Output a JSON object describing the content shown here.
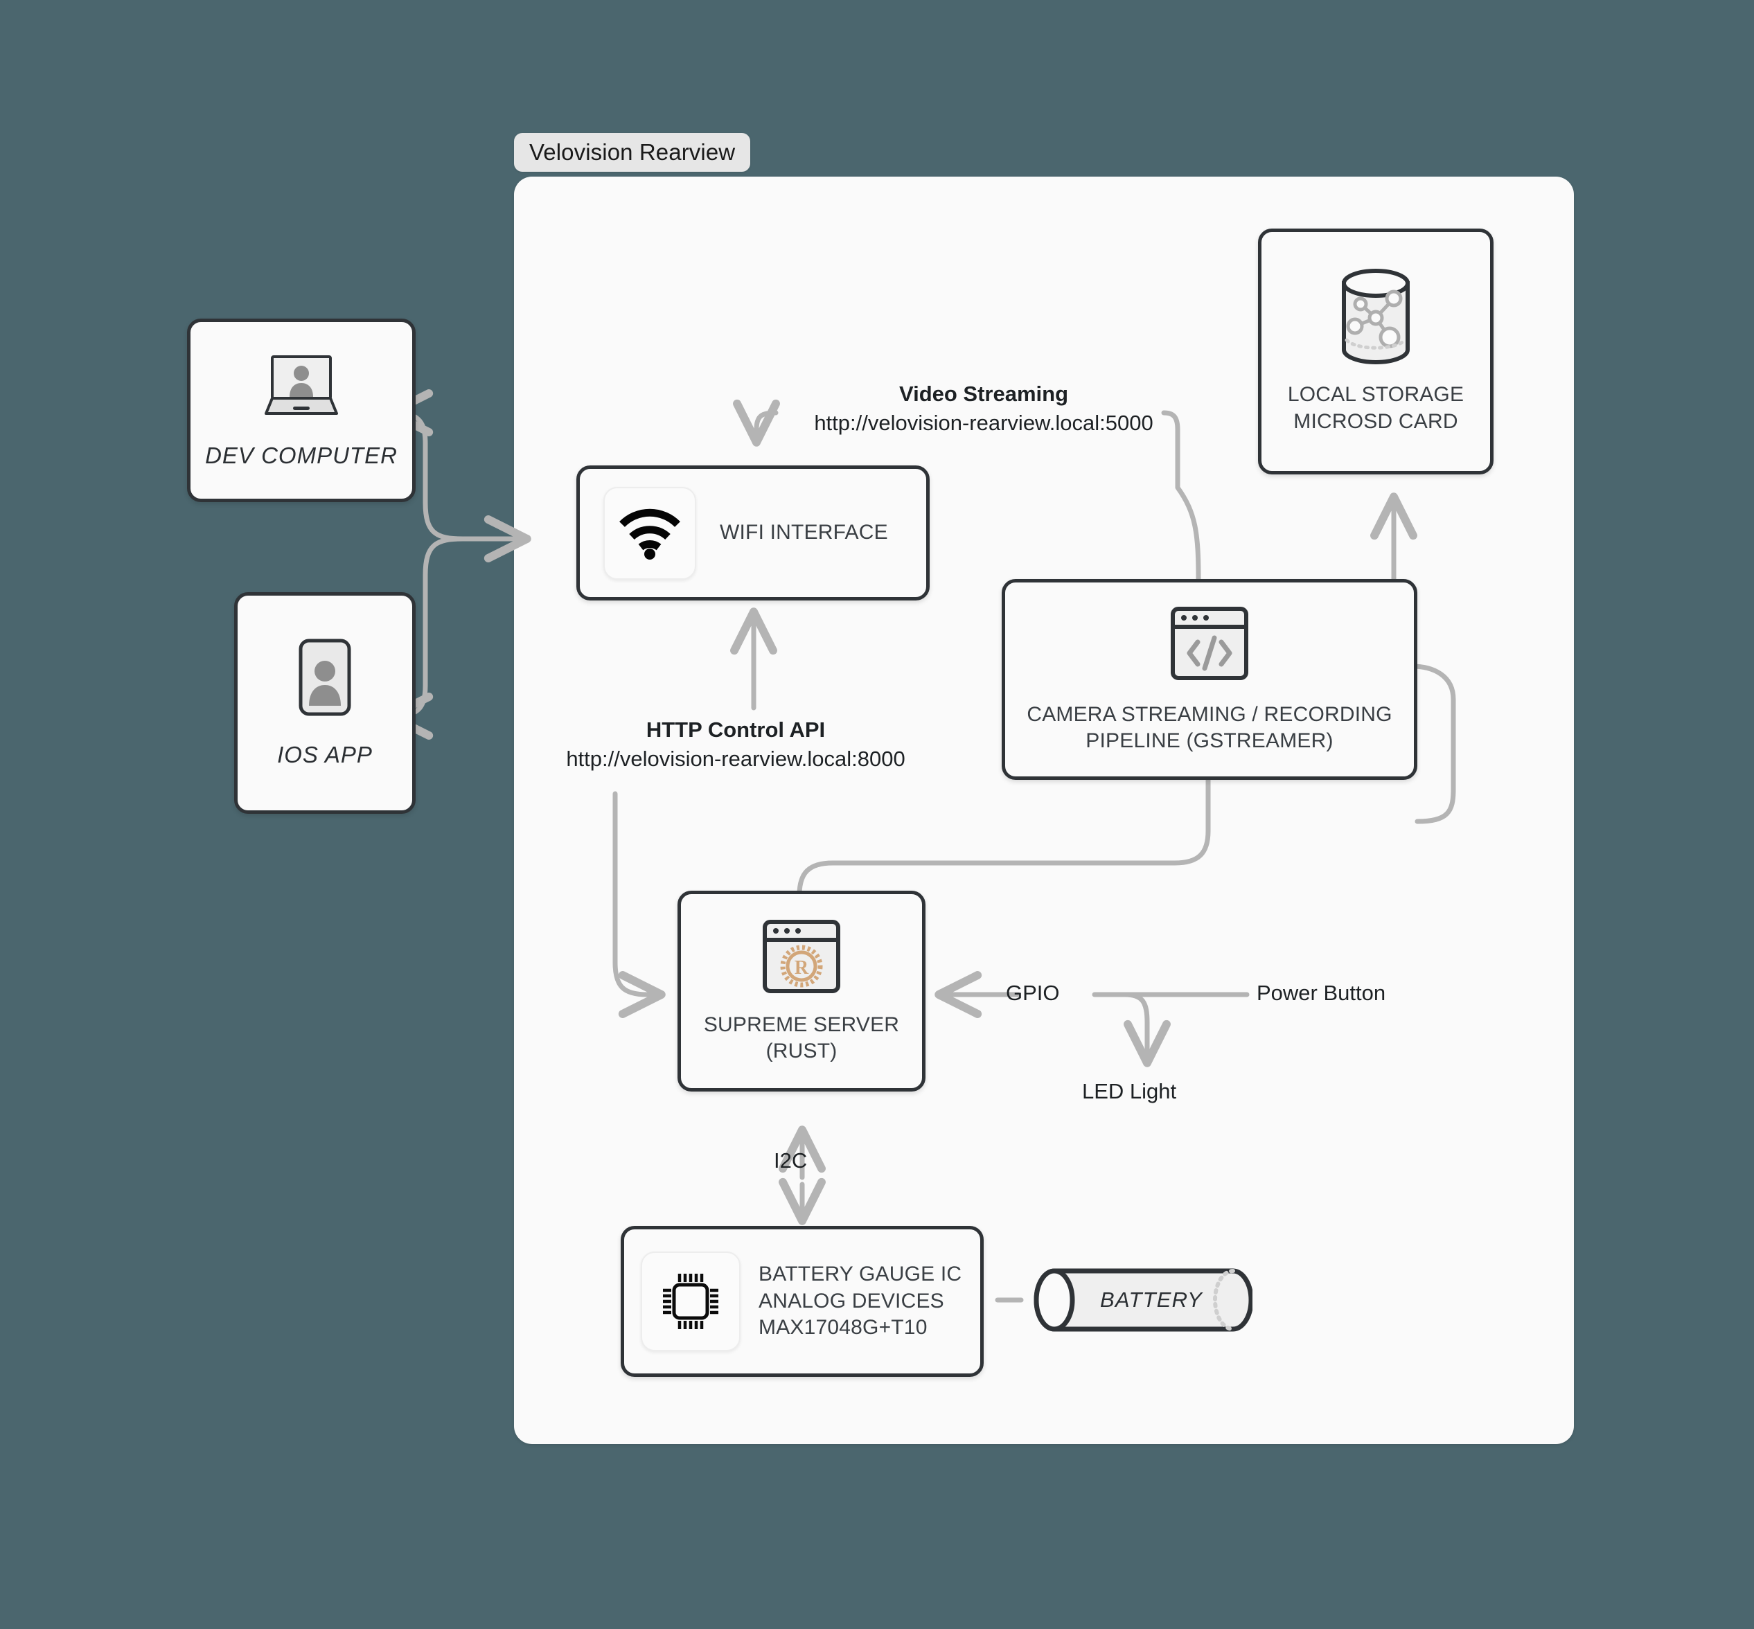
{
  "canvas": {
    "background_color": "#4b666e",
    "panel_color": "#fafafa",
    "node_border_color": "#2f3337",
    "wire_color": "#b4b4b4",
    "rust_logo_color": "#d2a679"
  },
  "group": {
    "label": "Velovision Rearview"
  },
  "nodes": {
    "dev_computer": {
      "label": "DEV COMPUTER",
      "icon": "laptop-user-icon"
    },
    "ios_app": {
      "label": "IOS APP",
      "icon": "phone-user-icon"
    },
    "wifi_interface": {
      "label": "WIFI INTERFACE",
      "icon": "wifi-icon"
    },
    "local_storage": {
      "label_line1": "LOCAL STORAGE",
      "label_line2": "MICROSD CARD",
      "icon": "database-cylinder-icon"
    },
    "camera_pipeline": {
      "label_line1": "CAMERA STREAMING / RECORDING",
      "label_line2": "PIPELINE (GSTREAMER)",
      "icon": "code-window-icon"
    },
    "supreme_server": {
      "label_line1": "SUPREME SERVER",
      "label_line2": "(RUST)",
      "icon": "rust-window-icon"
    },
    "battery_gauge": {
      "label_line1": "BATTERY GAUGE IC",
      "label_line2": "ANALOG DEVICES",
      "label_line3": "MAX17048G+T10",
      "icon": "chip-icon"
    },
    "battery": {
      "label": "BATTERY",
      "icon": "cylinder-icon"
    }
  },
  "edges": {
    "video_streaming": {
      "title": "Video Streaming",
      "url": "http://velovision-rearview.local:5000"
    },
    "http_control_api": {
      "title": "HTTP Control API",
      "url": "http://velovision-rearview.local:8000"
    },
    "gpio": {
      "label": "GPIO"
    },
    "power_button": {
      "label": "Power Button"
    },
    "led_light": {
      "label": "LED Light"
    },
    "i2c": {
      "label": "I2C"
    }
  }
}
